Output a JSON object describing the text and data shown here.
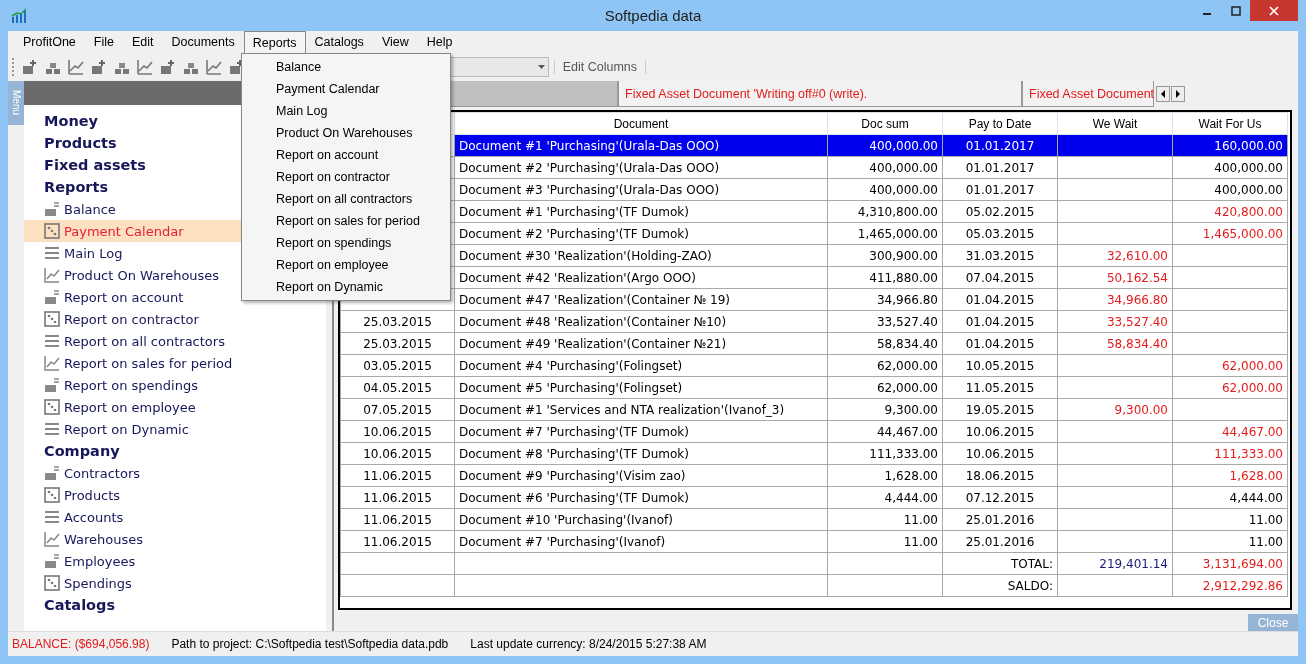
{
  "window": {
    "title": "Softpedia data"
  },
  "menubar": [
    {
      "label": "ProfitOne",
      "selected": false
    },
    {
      "label": "File",
      "selected": false
    },
    {
      "label": "Edit",
      "selected": false
    },
    {
      "label": "Documents",
      "selected": false
    },
    {
      "label": "Reports",
      "selected": true
    },
    {
      "label": "Catalogs",
      "selected": false
    },
    {
      "label": "View",
      "selected": false
    },
    {
      "label": "Help",
      "selected": false
    }
  ],
  "reports_menu": [
    "Balance",
    "Payment Calendar",
    "Main Log",
    "Product On Warehouses",
    "Report on account",
    "Report on contractor",
    "Report on all contractors",
    "Report on sales for period",
    "Report on spendings",
    "Report on employee",
    "Report on Dynamic"
  ],
  "toolbar": {
    "edit_columns": "Edit Columns"
  },
  "side_tab": "Menu",
  "sidebar": [
    {
      "kind": "heading",
      "label": "Money"
    },
    {
      "kind": "heading",
      "label": "Products"
    },
    {
      "kind": "heading",
      "label": "Fixed assets"
    },
    {
      "kind": "heading",
      "label": "Reports"
    },
    {
      "kind": "item",
      "label": "Balance",
      "selected": false
    },
    {
      "kind": "item",
      "label": "Payment Calendar",
      "selected": true
    },
    {
      "kind": "item",
      "label": "Main Log",
      "selected": false
    },
    {
      "kind": "item",
      "label": "Product On Warehouses",
      "selected": false
    },
    {
      "kind": "item",
      "label": "Report on account",
      "selected": false
    },
    {
      "kind": "item",
      "label": "Report on contractor",
      "selected": false
    },
    {
      "kind": "item",
      "label": "Report on all contractors",
      "selected": false
    },
    {
      "kind": "item",
      "label": "Report on sales for period",
      "selected": false
    },
    {
      "kind": "item",
      "label": "Report on spendings",
      "selected": false
    },
    {
      "kind": "item",
      "label": "Report on employee",
      "selected": false
    },
    {
      "kind": "item",
      "label": "Report on Dynamic",
      "selected": false
    },
    {
      "kind": "heading",
      "label": "Company"
    },
    {
      "kind": "item",
      "label": "Contractors",
      "selected": false
    },
    {
      "kind": "item",
      "label": "Products",
      "selected": false
    },
    {
      "kind": "item",
      "label": "Accounts",
      "selected": false
    },
    {
      "kind": "item",
      "label": "Warehouses",
      "selected": false
    },
    {
      "kind": "item",
      "label": "Employees",
      "selected": false
    },
    {
      "kind": "item",
      "label": "Spendings",
      "selected": false
    },
    {
      "kind": "heading",
      "label": "Catalogs"
    }
  ],
  "tabs": [
    {
      "selected": true
    },
    {
      "label": "Fixed Asset Document 'Writing off#0 (write).",
      "selected": false
    },
    {
      "label": "Fixed Asset Document",
      "selected": false
    }
  ],
  "table": {
    "columns": [
      "Document",
      "Doc sum",
      "Pay to Date",
      "We Wait",
      "Wait For Us"
    ],
    "rows": [
      {
        "date": "",
        "document": "Document #1 'Purchasing'(Urala-Das OOO)",
        "doc_sum": "400,000.00",
        "pay_to_date": "01.01.2017",
        "we_wait": "",
        "wait_for_us": "160,000.00",
        "overdue": false,
        "selected": true
      },
      {
        "date": "",
        "document": "Document #2 'Purchasing'(Urala-Das OOO)",
        "doc_sum": "400,000.00",
        "pay_to_date": "01.01.2017",
        "we_wait": "",
        "wait_for_us": "400,000.00",
        "overdue": false,
        "selected": false
      },
      {
        "date": "",
        "document": "Document #3 'Purchasing'(Urala-Das OOO)",
        "doc_sum": "400,000.00",
        "pay_to_date": "01.01.2017",
        "we_wait": "",
        "wait_for_us": "400,000.00",
        "overdue": false,
        "selected": false
      },
      {
        "date": "",
        "document": "Document #1 'Purchasing'(TF Dumok)",
        "doc_sum": "4,310,800.00",
        "pay_to_date": "05.02.2015",
        "we_wait": "",
        "wait_for_us": "420,800.00",
        "overdue": true,
        "selected": false
      },
      {
        "date": "",
        "document": "Document #2 'Purchasing'(TF Dumok)",
        "doc_sum": "1,465,000.00",
        "pay_to_date": "05.03.2015",
        "we_wait": "",
        "wait_for_us": "1,465,000.00",
        "overdue": true,
        "selected": false
      },
      {
        "date": "",
        "document": "Document #30 'Realization'(Holding-ZAO)",
        "doc_sum": "300,900.00",
        "pay_to_date": "31.03.2015",
        "we_wait": "32,610.00",
        "wait_for_us": "",
        "selected": false
      },
      {
        "date": "",
        "document": "Document #42 'Realization'(Argo OOO)",
        "doc_sum": "411,880.00",
        "pay_to_date": "07.04.2015",
        "we_wait": "50,162.54",
        "wait_for_us": "",
        "selected": false
      },
      {
        "date": "",
        "document": "Document #47 'Realization'(Container № 19)",
        "doc_sum": "34,966.80",
        "pay_to_date": "01.04.2015",
        "we_wait": "34,966.80",
        "wait_for_us": "",
        "selected": false
      },
      {
        "date": "25.03.2015",
        "document": "Document #48 'Realization'(Container №10)",
        "doc_sum": "33,527.40",
        "pay_to_date": "01.04.2015",
        "we_wait": "33,527.40",
        "wait_for_us": "",
        "selected": false
      },
      {
        "date": "25.03.2015",
        "document": "Document #49 'Realization'(Container №21)",
        "doc_sum": "58,834.40",
        "pay_to_date": "01.04.2015",
        "we_wait": "58,834.40",
        "wait_for_us": "",
        "selected": false
      },
      {
        "date": "03.05.2015",
        "document": "Document #4 'Purchasing'(Folingset)",
        "doc_sum": "62,000.00",
        "pay_to_date": "10.05.2015",
        "we_wait": "",
        "wait_for_us": "62,000.00",
        "overdue": true,
        "selected": false
      },
      {
        "date": "04.05.2015",
        "document": "Document #5 'Purchasing'(Folingset)",
        "doc_sum": "62,000.00",
        "pay_to_date": "11.05.2015",
        "we_wait": "",
        "wait_for_us": "62,000.00",
        "overdue": true,
        "selected": false
      },
      {
        "date": "07.05.2015",
        "document": "Document #1 'Services and NTA realization'(Ivanof_3)",
        "doc_sum": "9,300.00",
        "pay_to_date": "19.05.2015",
        "we_wait": "9,300.00",
        "wait_for_us": "",
        "selected": false
      },
      {
        "date": "10.06.2015",
        "document": "Document #7 'Purchasing'(TF Dumok)",
        "doc_sum": "44,467.00",
        "pay_to_date": "10.06.2015",
        "we_wait": "",
        "wait_for_us": "44,467.00",
        "overdue": true,
        "selected": false
      },
      {
        "date": "10.06.2015",
        "document": "Document #8 'Purchasing'(TF Dumok)",
        "doc_sum": "111,333.00",
        "pay_to_date": "10.06.2015",
        "we_wait": "",
        "wait_for_us": "111,333.00",
        "overdue": true,
        "selected": false
      },
      {
        "date": "11.06.2015",
        "document": "Document #9 'Purchasing'(Visim zao)",
        "doc_sum": "1,628.00",
        "pay_to_date": "18.06.2015",
        "we_wait": "",
        "wait_for_us": "1,628.00",
        "overdue": true,
        "selected": false
      },
      {
        "date": "11.06.2015",
        "document": "Document #6 'Purchasing'(TF Dumok)",
        "doc_sum": "4,444.00",
        "pay_to_date": "07.12.2015",
        "we_wait": "",
        "wait_for_us": "4,444.00",
        "overdue": false,
        "selected": false
      },
      {
        "date": "11.06.2015",
        "document": "Document #10 'Purchasing'(Ivanof)",
        "doc_sum": "11.00",
        "pay_to_date": "25.01.2016",
        "we_wait": "",
        "wait_for_us": "11.00",
        "overdue": false,
        "selected": false
      },
      {
        "date": "11.06.2015",
        "document": "Document #7 'Purchasing'(Ivanof)",
        "doc_sum": "11.00",
        "pay_to_date": "25.01.2016",
        "we_wait": "",
        "wait_for_us": "11.00",
        "overdue": false,
        "selected": false
      }
    ],
    "total": {
      "label": "TOTAL:",
      "we_wait": "219,401.14",
      "wait_for_us": "3,131,694.00"
    },
    "saldo": {
      "label": "SALDO:",
      "wait_for_us": "2,912,292.86"
    }
  },
  "close_button": "Close",
  "status_bar": {
    "balance": "BALANCE: ($694,056.98)",
    "path": "Path to project: C:\\Softpedia test\\Softpedia data.pdb",
    "update": "Last update currency: 8/24/2015 5:27:38 AM"
  }
}
